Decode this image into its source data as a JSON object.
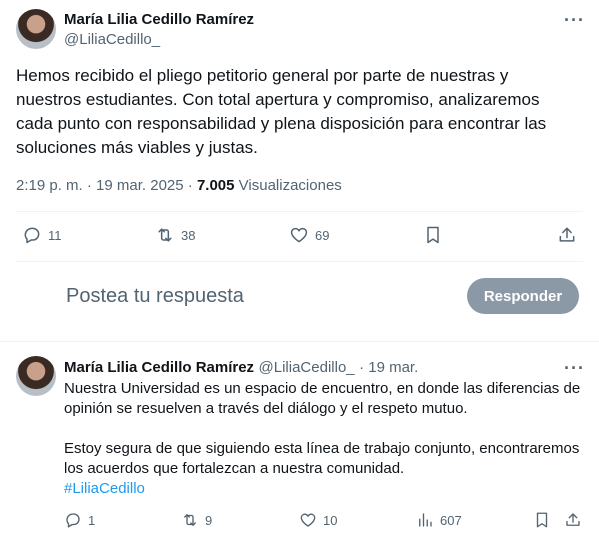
{
  "main_post": {
    "author_name": "María Lilia Cedillo Ramírez",
    "handle": "@LiliaCedillo_",
    "text": "Hemos recibido el pliego petitorio general por parte de nuestras y nuestros estudiantes. Con total apertura y compromiso, analizaremos cada punto con responsabilidad y plena disposición para encontrar las soluciones más viables y justas.",
    "time": "2:19 p. m.",
    "separator": "·",
    "date": "19 mar. 2025",
    "views_count": "7.005",
    "views_label": "Visualizaciones",
    "replies": "11",
    "reposts": "38",
    "likes": "69"
  },
  "reply_box": {
    "placeholder": "Postea tu respuesta",
    "button_label": "Responder"
  },
  "reply_post": {
    "author_name": "María Lilia Cedillo Ramírez",
    "handle": "@LiliaCedillo_",
    "date": "· 19 mar.",
    "paragraph1": "Nuestra Universidad es un espacio de encuentro, en donde las diferencias de opinión se resuelven a través del diálogo y el respeto mutuo.",
    "paragraph2": "Estoy segura de que siguiendo esta línea de trabajo conjunto, encontraremos los acuerdos que fortalezcan a nuestra comunidad.",
    "hashtag": "#LiliaCedillo",
    "replies": "1",
    "reposts": "9",
    "likes": "10",
    "views": "607"
  },
  "icons": {
    "more": "more-icon",
    "reply": "reply-icon",
    "repost": "repost-icon",
    "like": "heart-icon",
    "bookmark": "bookmark-icon",
    "share": "share-icon",
    "views": "analytics-icon"
  },
  "colors": {
    "text": "#0f1419",
    "secondary": "#536471",
    "link": "#1d9bf0",
    "button": "#8b98a5",
    "divider": "#eff3f4"
  }
}
